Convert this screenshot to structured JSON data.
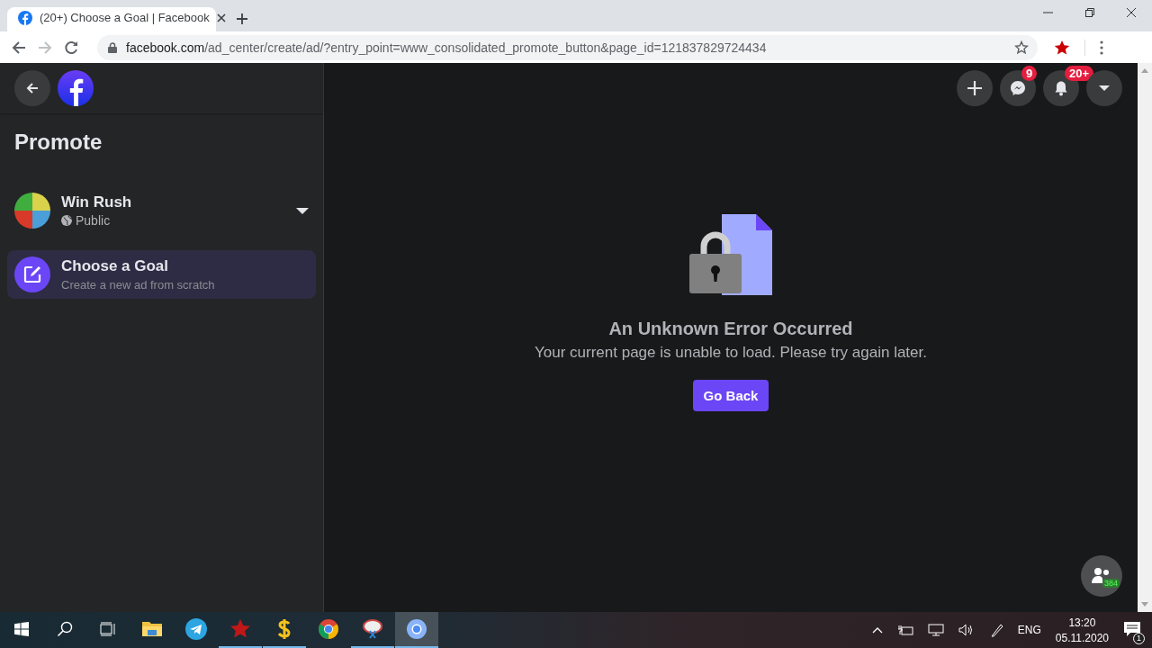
{
  "browser": {
    "tab": {
      "title": "(20+) Choose a Goal | Facebook",
      "selected": true
    },
    "url_host": "facebook.com",
    "url_path": "/ad_center/create/ad/?entry_point=www_consolidated_promote_button&page_id=121837829724434"
  },
  "sidebar": {
    "title": "Promote",
    "profile": {
      "name": "Win Rush",
      "audience": "Public"
    },
    "items": [
      {
        "title": "Choose a Goal",
        "subtitle": "Create a new ad from scratch",
        "selected": true
      }
    ]
  },
  "top_actions": [
    {
      "kind": "plus"
    },
    {
      "kind": "messenger",
      "badge": "9"
    },
    {
      "kind": "bell",
      "badge": "20+"
    },
    {
      "kind": "caret"
    }
  ],
  "error": {
    "title": "An Unknown Error Occurred",
    "message": "Your current page is unable to load. Please try again later.",
    "button": "Go Back"
  },
  "contacts_badge": "384",
  "taskbar": {
    "apps": [
      {
        "kind": "folder",
        "running": false,
        "selected": false
      },
      {
        "kind": "telegram",
        "running": false,
        "selected": false
      },
      {
        "kind": "star",
        "running": true,
        "selected": false
      },
      {
        "kind": "dollar",
        "running": true,
        "selected": false
      },
      {
        "kind": "chrome",
        "running": false,
        "selected": false
      },
      {
        "kind": "paint",
        "running": true,
        "selected": false
      },
      {
        "kind": "chrome-blue",
        "running": true,
        "selected": true
      }
    ],
    "language": "ENG",
    "time": "13:20",
    "date": "05.11.2020",
    "notifications": "1"
  }
}
